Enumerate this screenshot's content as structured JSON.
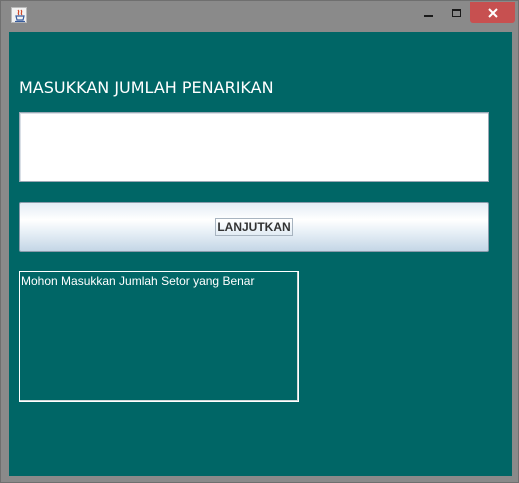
{
  "window": {
    "icon": "java-cup-icon",
    "controls": {
      "minimize": "minimize-icon",
      "maximize": "maximize-icon",
      "close": "close-icon"
    }
  },
  "form": {
    "heading": "MASUKKAN JUMLAH PENARIKAN",
    "amount_value": "",
    "continue_label": "LANJUTKAN",
    "message": "Mohon Masukkan Jumlah Setor yang Benar"
  },
  "colors": {
    "background": "#006666",
    "close_button": "#c75050",
    "frame": "#8a8a8a"
  }
}
